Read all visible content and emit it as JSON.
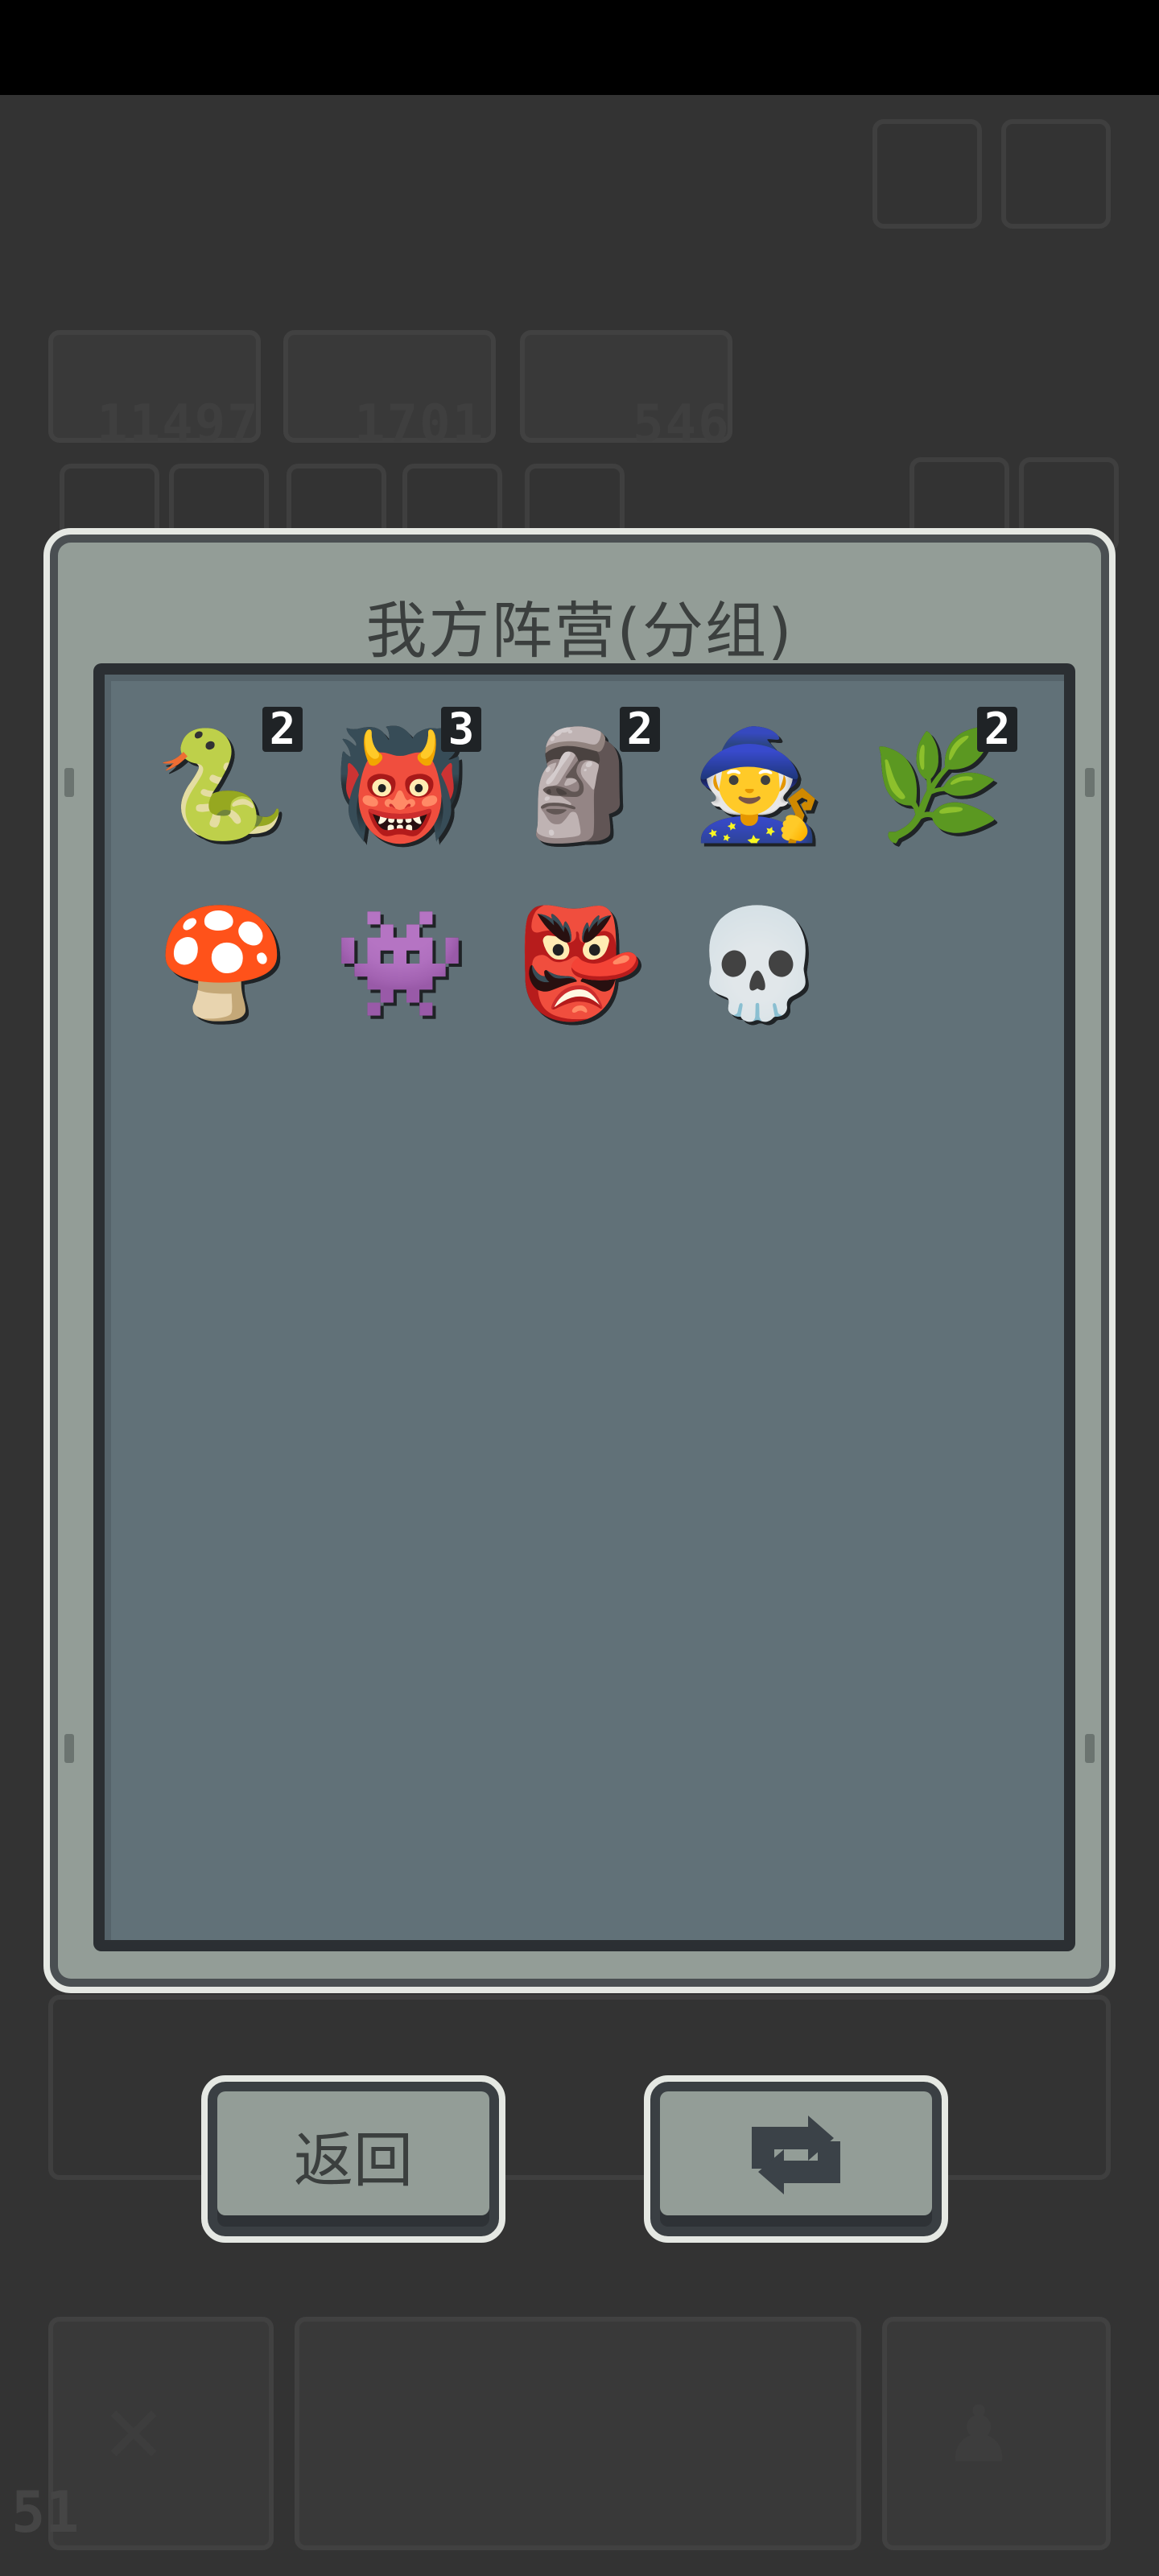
{
  "dialog": {
    "title": "我方阵营(分组)"
  },
  "units": [
    {
      "name": "Green Serpent",
      "count": "2",
      "glyph": "🐍",
      "color": "#5aa46a"
    },
    {
      "name": "Violet Demon",
      "count": "3",
      "glyph": "👹",
      "color": "#c768d8"
    },
    {
      "name": "Stone Golem",
      "count": "2",
      "glyph": "🗿",
      "color": "#9aa7b1"
    },
    {
      "name": "White Sage",
      "count": "",
      "glyph": "🧙",
      "color": "#e7e7e7"
    },
    {
      "name": "Thorn Bush",
      "count": "2",
      "glyph": "🌿",
      "color": "#b8573f"
    },
    {
      "name": "Orange Mushroom",
      "count": "",
      "glyph": "🍄",
      "color": "#d9793f"
    },
    {
      "name": "Shadow Beast",
      "count": "",
      "glyph": "👾",
      "color": "#2c4650"
    },
    {
      "name": "Purple Wraith",
      "count": "",
      "glyph": "👺",
      "color": "#9a44c9"
    },
    {
      "name": "Pale Archer",
      "count": "",
      "glyph": "💀",
      "color": "#e9e9e9"
    }
  ],
  "buttons": {
    "back_label": "返回",
    "swap_icon": "swap-arrows-icon"
  },
  "background": {
    "resource_1": "11497",
    "resource_2": "1701",
    "resource_3": "546",
    "level": "51"
  },
  "colors": {
    "dialog_bg": "#939d97",
    "panel_bg": "#617178",
    "frame": "#e5e8e3",
    "backdrop": "#333333"
  }
}
